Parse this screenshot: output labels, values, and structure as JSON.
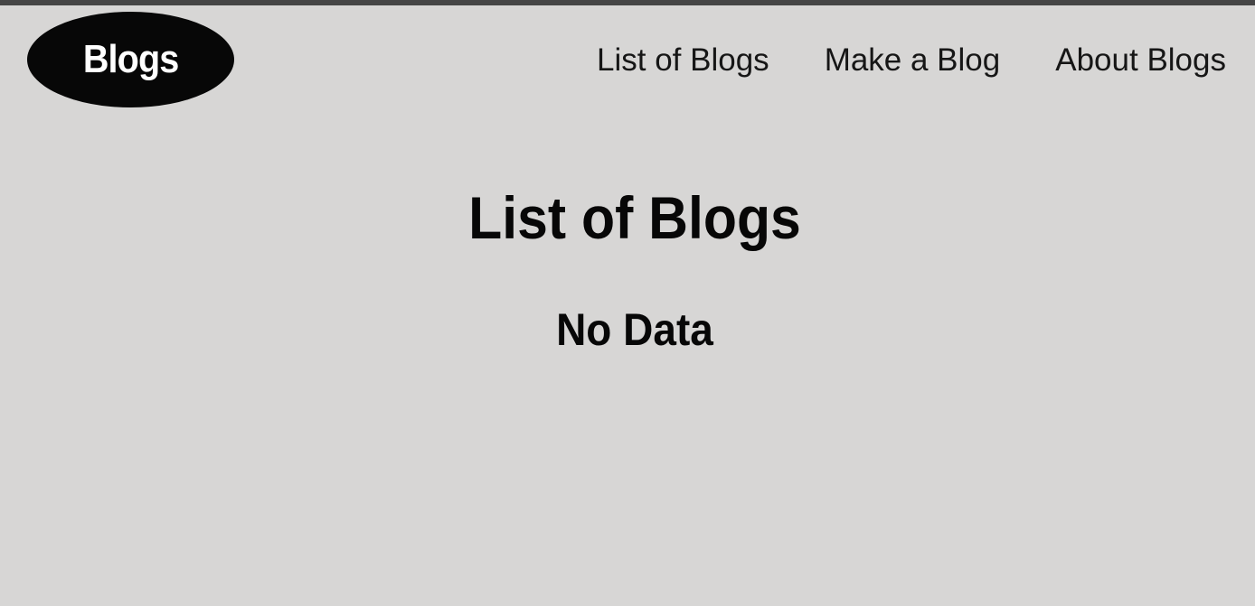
{
  "colors": {
    "background": "#d7d6d5",
    "top_strip": "#454545",
    "logo_background": "#070707",
    "logo_text": "#ffffff",
    "text": "#111111"
  },
  "navbar": {
    "logo_text": "Blogs",
    "links": [
      {
        "label": "List of Blogs"
      },
      {
        "label": "Make a Blog"
      },
      {
        "label": "About Blogs"
      }
    ]
  },
  "main": {
    "title": "List of Blogs",
    "empty_message": "No Data"
  }
}
